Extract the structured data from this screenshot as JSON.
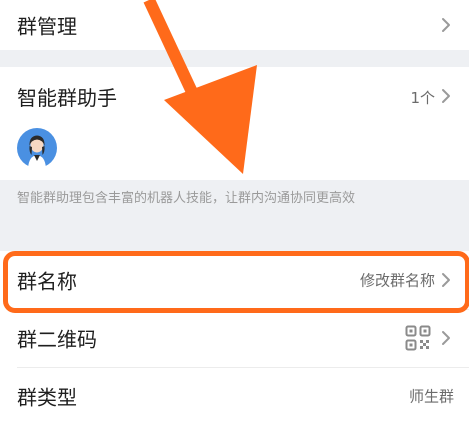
{
  "rows": {
    "group_manage": {
      "label": "群管理"
    },
    "smart_assistant": {
      "label": "智能群助手",
      "count": "1个"
    },
    "assistant_desc": "智能群助理包含丰富的机器人技能，让群内沟通协同更高效",
    "group_name": {
      "label": "群名称",
      "value": "修改群名称"
    },
    "qr_code": {
      "label": "群二维码"
    },
    "group_type": {
      "label": "群类型",
      "value": "师生群"
    }
  },
  "colors": {
    "highlight": "#ff6a1a",
    "background": "#eef0f3",
    "avatar_bg": "#4a90e2"
  },
  "icons": [
    "chevron-right-icon",
    "qr-code-icon",
    "assistant-avatar",
    "arrow-annotation"
  ]
}
